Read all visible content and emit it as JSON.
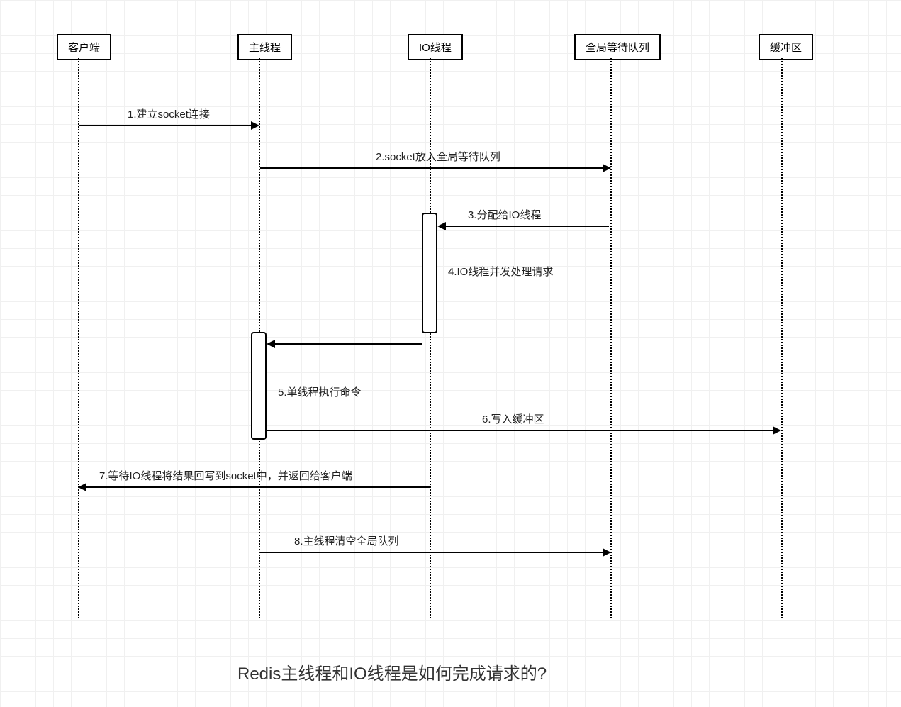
{
  "diagram": {
    "type": "sequence",
    "participants": {
      "client": "客户端",
      "main_thread": "主线程",
      "io_thread": "IO线程",
      "wait_queue": "全局等待队列",
      "buffer": "缓冲区"
    },
    "messages": {
      "m1": "1.建立socket连接",
      "m2": "2.socket放入全局等待队列",
      "m3": "3.分配给IO线程",
      "m4": "4.IO线程并发处理请求",
      "m5": "5.单线程执行命令",
      "m6": "6.写入缓冲区",
      "m7": "7.等待IO线程将结果回写到socket中，并返回给客户端",
      "m8": "8.主线程清空全局队列"
    },
    "caption": "Redis主线程和IO线程是如何完成请求的?"
  },
  "chart_data": {
    "type": "sequence",
    "participants": [
      "客户端",
      "主线程",
      "IO线程",
      "全局等待队列",
      "缓冲区"
    ],
    "messages": [
      {
        "from": "客户端",
        "to": "主线程",
        "label": "1.建立socket连接"
      },
      {
        "from": "主线程",
        "to": "全局等待队列",
        "label": "2.socket放入全局等待队列"
      },
      {
        "from": "全局等待队列",
        "to": "IO线程",
        "label": "3.分配给IO线程"
      },
      {
        "from": "IO线程",
        "to": "IO线程",
        "label": "4.IO线程并发处理请求",
        "activation": true
      },
      {
        "from": "IO线程",
        "to": "主线程",
        "label": "",
        "activation_start": true
      },
      {
        "from": "主线程",
        "to": "主线程",
        "label": "5.单线程执行命令"
      },
      {
        "from": "主线程",
        "to": "缓冲区",
        "label": "6.写入缓冲区"
      },
      {
        "from": "IO线程",
        "to": "客户端",
        "label": "7.等待IO线程将结果回写到socket中，并返回给客户端"
      },
      {
        "from": "主线程",
        "to": "全局等待队列",
        "label": "8.主线程清空全局队列"
      }
    ],
    "title": "Redis主线程和IO线程是如何完成请求的?"
  }
}
